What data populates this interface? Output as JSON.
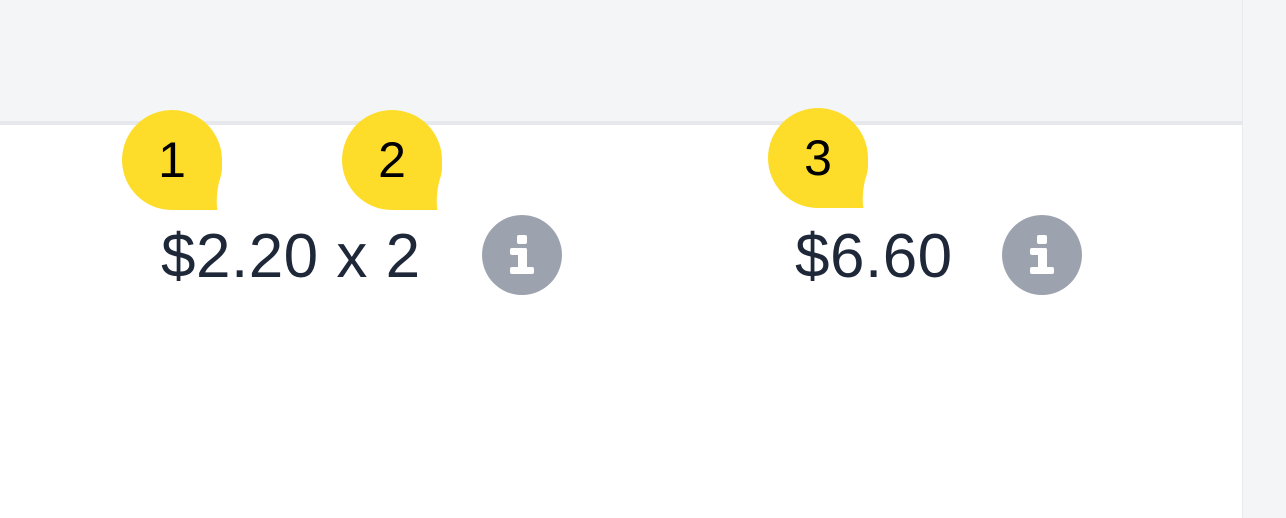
{
  "colors": {
    "header_bg": "#f4f5f7",
    "divider": "#e6e8eb",
    "text": "#1f2838",
    "info_icon_bg": "#9ca3af",
    "badge_bg": "#fddd2a"
  },
  "row": {
    "unit_price": "$2.20 x 2",
    "total": "$6.60",
    "unit_price_info_icon": "info-icon",
    "total_info_icon": "info-icon"
  },
  "badges": [
    {
      "label": "1"
    },
    {
      "label": "2"
    },
    {
      "label": "3"
    }
  ]
}
